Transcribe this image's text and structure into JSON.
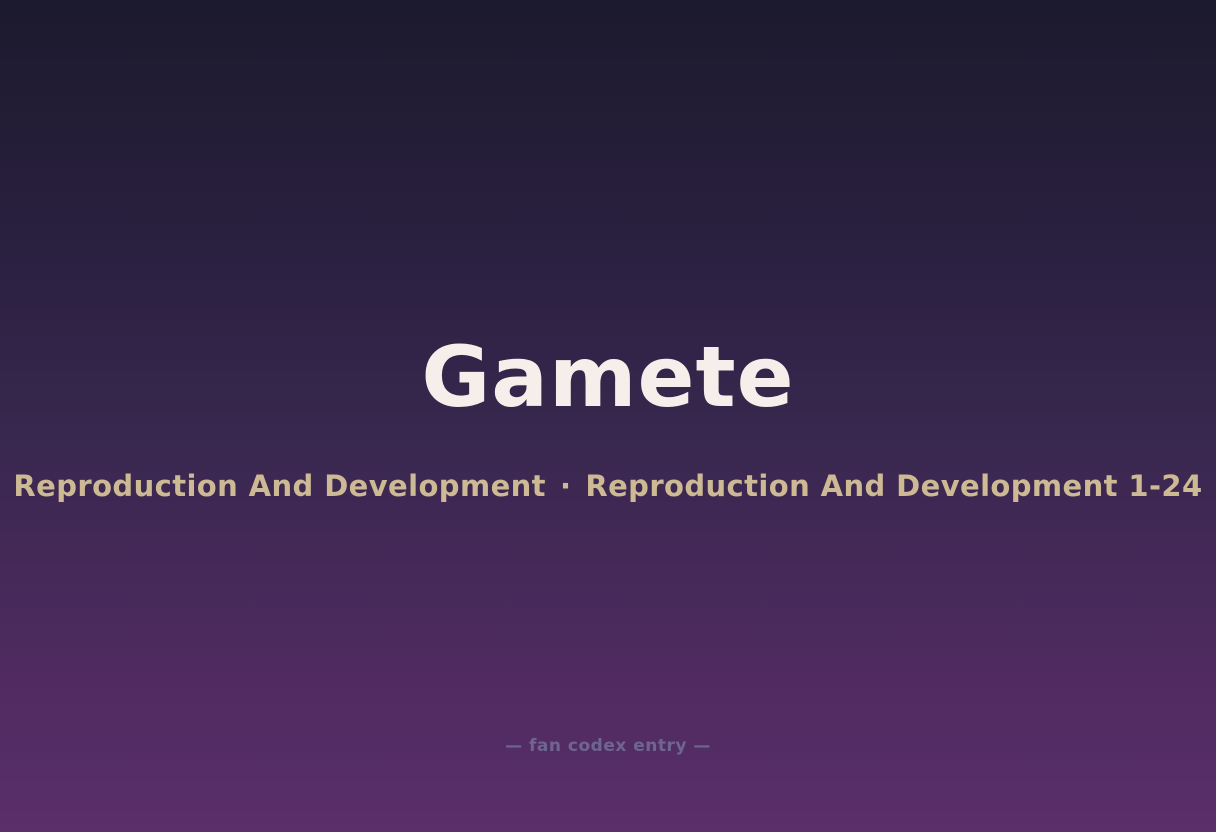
{
  "entry": {
    "title": "Gamete",
    "category": "Reproduction And Development",
    "separator": "·",
    "section": "Reproduction And Development 1-24",
    "footer": "— fan codex entry —"
  },
  "colors": {
    "background_top": "#1c1a2d",
    "background_bottom": "#5a2f6a",
    "title": "#f6eeea",
    "subtitle": "#cdb994",
    "footer": "#6e6690"
  }
}
